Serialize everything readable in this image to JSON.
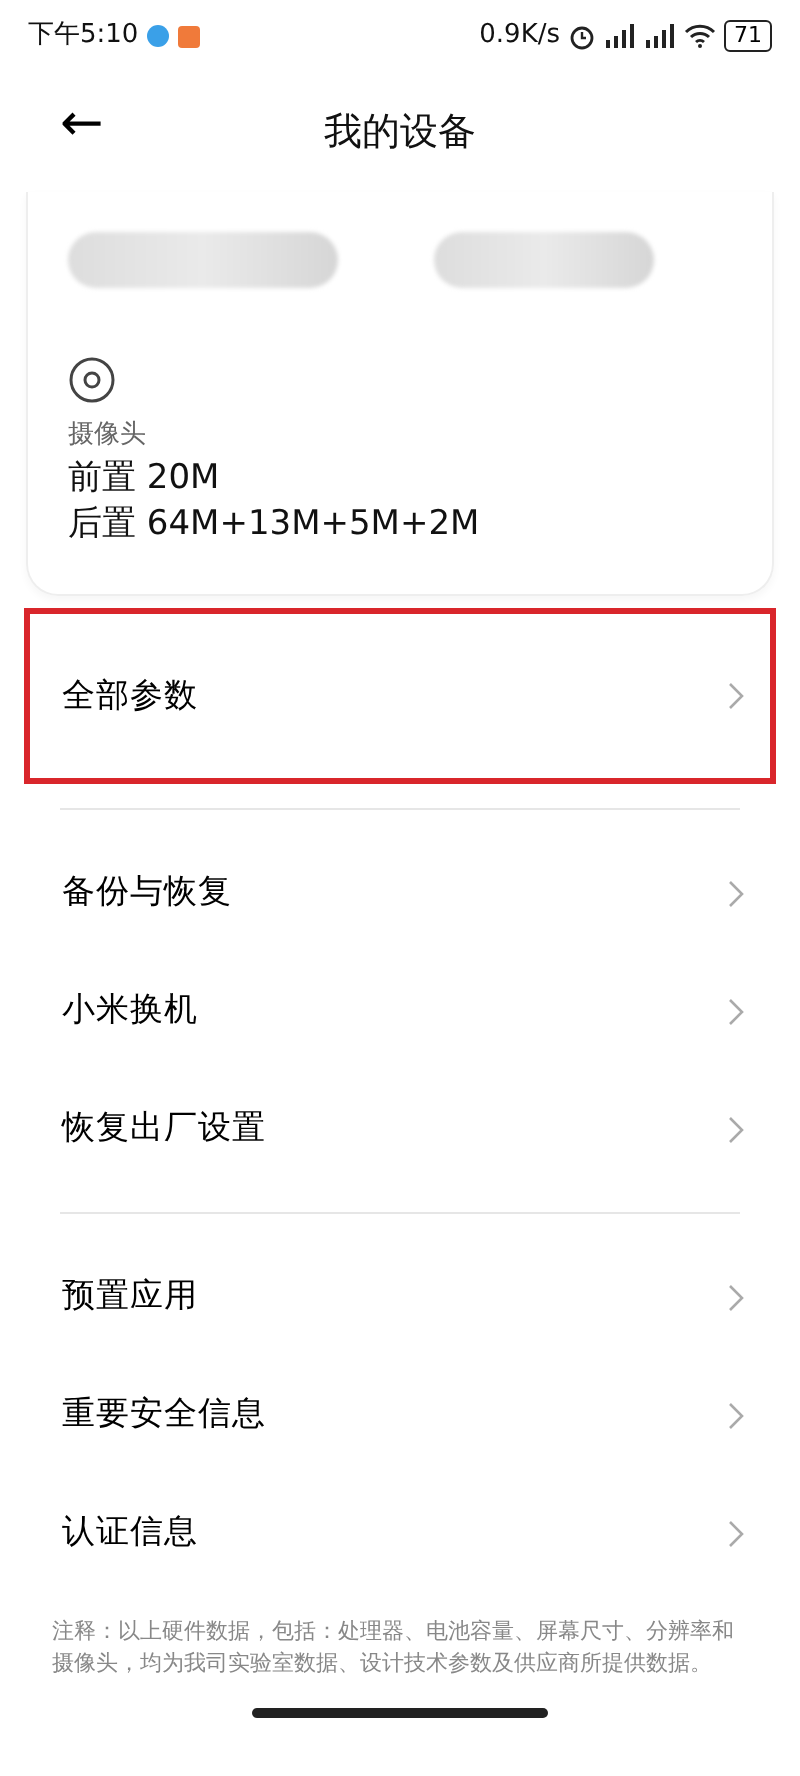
{
  "status_bar": {
    "time": "下午5:10",
    "speed": "0.9K/s",
    "battery": "71"
  },
  "header": {
    "back": "←",
    "title": "我的设备"
  },
  "camera_card": {
    "label": "摄像头",
    "lines": [
      "前置 20M",
      "后置 64M+13M+5M+2M"
    ]
  },
  "groups": [
    [
      {
        "label": "全部参数",
        "highlighted": true
      }
    ],
    [
      {
        "label": "备份与恢复",
        "highlighted": false
      },
      {
        "label": "小米换机",
        "highlighted": false
      },
      {
        "label": "恢复出厂设置",
        "highlighted": false
      }
    ],
    [
      {
        "label": "预置应用",
        "highlighted": false
      },
      {
        "label": "重要安全信息",
        "highlighted": false
      },
      {
        "label": "认证信息",
        "highlighted": false
      }
    ]
  ],
  "note": "注释：以上硬件数据，包括：处理器、电池容量、屏幕尺寸、分辨率和摄像头，均为我司实验室数据、设计技术参数及供应商所提供数据。"
}
